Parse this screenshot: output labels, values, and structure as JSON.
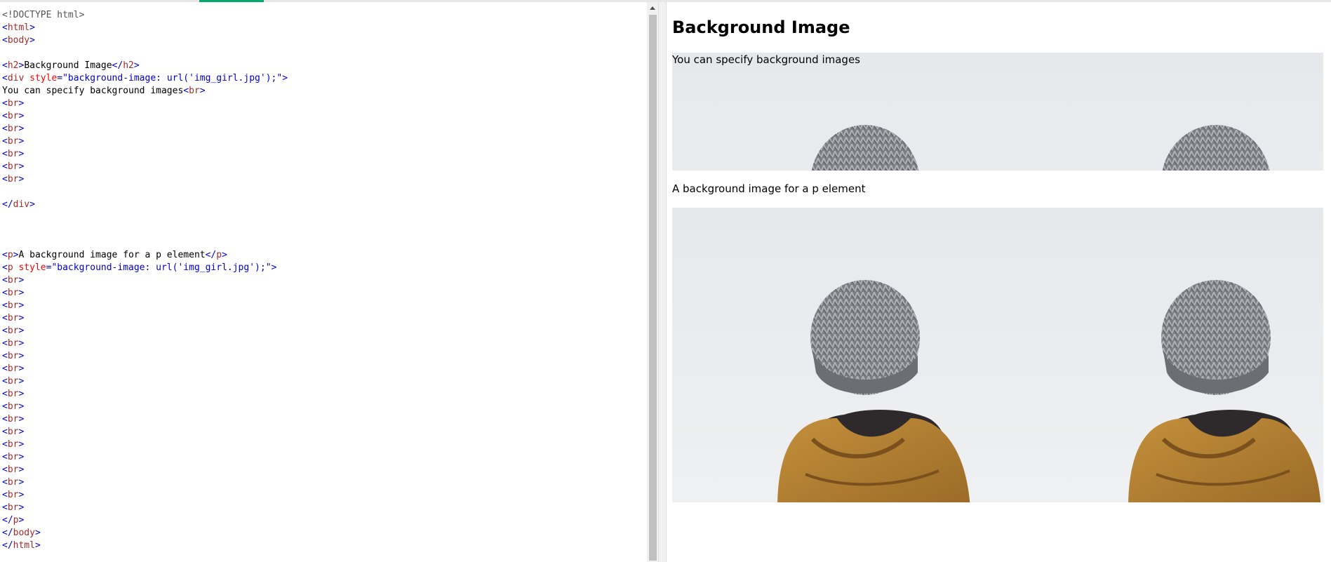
{
  "editor": {
    "lines": [
      {
        "tokens": [
          {
            "t": "doctype",
            "v": "<!DOCTYPE html>"
          }
        ]
      },
      {
        "tokens": [
          {
            "t": "angle",
            "v": "<"
          },
          {
            "t": "tag",
            "v": "html"
          },
          {
            "t": "angle",
            "v": ">"
          }
        ]
      },
      {
        "tokens": [
          {
            "t": "angle",
            "v": "<"
          },
          {
            "t": "tag",
            "v": "body"
          },
          {
            "t": "angle",
            "v": ">"
          }
        ]
      },
      {
        "tokens": []
      },
      {
        "tokens": [
          {
            "t": "angle",
            "v": "<"
          },
          {
            "t": "tag",
            "v": "h2"
          },
          {
            "t": "angle",
            "v": ">"
          },
          {
            "t": "text",
            "v": "Background Image"
          },
          {
            "t": "angle",
            "v": "</"
          },
          {
            "t": "tag",
            "v": "h2"
          },
          {
            "t": "angle",
            "v": ">"
          }
        ]
      },
      {
        "tokens": [
          {
            "t": "angle",
            "v": "<"
          },
          {
            "t": "tag",
            "v": "div"
          },
          {
            "t": "text",
            "v": " "
          },
          {
            "t": "attr",
            "v": "style"
          },
          {
            "t": "val",
            "v": "=\"background-image: url('img_girl.jpg');\""
          },
          {
            "t": "angle",
            "v": ">"
          }
        ]
      },
      {
        "tokens": [
          {
            "t": "text",
            "v": "You can specify background images"
          },
          {
            "t": "angle",
            "v": "<"
          },
          {
            "t": "tag",
            "v": "br"
          },
          {
            "t": "angle",
            "v": ">"
          }
        ]
      },
      {
        "tokens": [
          {
            "t": "angle",
            "v": "<"
          },
          {
            "t": "tag",
            "v": "br"
          },
          {
            "t": "angle",
            "v": ">"
          }
        ]
      },
      {
        "tokens": [
          {
            "t": "angle",
            "v": "<"
          },
          {
            "t": "tag",
            "v": "br"
          },
          {
            "t": "angle",
            "v": ">"
          }
        ]
      },
      {
        "tokens": [
          {
            "t": "angle",
            "v": "<"
          },
          {
            "t": "tag",
            "v": "br"
          },
          {
            "t": "angle",
            "v": ">"
          }
        ]
      },
      {
        "tokens": [
          {
            "t": "angle",
            "v": "<"
          },
          {
            "t": "tag",
            "v": "br"
          },
          {
            "t": "angle",
            "v": ">"
          }
        ]
      },
      {
        "tokens": [
          {
            "t": "angle",
            "v": "<"
          },
          {
            "t": "tag",
            "v": "br"
          },
          {
            "t": "angle",
            "v": ">"
          }
        ]
      },
      {
        "tokens": [
          {
            "t": "angle",
            "v": "<"
          },
          {
            "t": "tag",
            "v": "br"
          },
          {
            "t": "angle",
            "v": ">"
          }
        ]
      },
      {
        "tokens": [
          {
            "t": "angle",
            "v": "<"
          },
          {
            "t": "tag",
            "v": "br"
          },
          {
            "t": "angle",
            "v": ">"
          }
        ]
      },
      {
        "tokens": []
      },
      {
        "tokens": [
          {
            "t": "angle",
            "v": "</"
          },
          {
            "t": "tag",
            "v": "div"
          },
          {
            "t": "angle",
            "v": ">"
          }
        ]
      },
      {
        "tokens": []
      },
      {
        "tokens": []
      },
      {
        "tokens": []
      },
      {
        "tokens": [
          {
            "t": "angle",
            "v": "<"
          },
          {
            "t": "tag",
            "v": "p"
          },
          {
            "t": "angle",
            "v": ">"
          },
          {
            "t": "text",
            "v": "A background image for a p element"
          },
          {
            "t": "angle",
            "v": "</"
          },
          {
            "t": "tag",
            "v": "p"
          },
          {
            "t": "angle",
            "v": ">"
          }
        ]
      },
      {
        "tokens": [
          {
            "t": "angle",
            "v": "<"
          },
          {
            "t": "tag",
            "v": "p"
          },
          {
            "t": "text",
            "v": " "
          },
          {
            "t": "attr",
            "v": "style"
          },
          {
            "t": "val",
            "v": "=\"background-image: url('img_girl.jpg');\""
          },
          {
            "t": "angle",
            "v": ">"
          }
        ]
      },
      {
        "tokens": [
          {
            "t": "angle",
            "v": "<"
          },
          {
            "t": "tag",
            "v": "br"
          },
          {
            "t": "angle",
            "v": ">"
          }
        ]
      },
      {
        "tokens": [
          {
            "t": "angle",
            "v": "<"
          },
          {
            "t": "tag",
            "v": "br"
          },
          {
            "t": "angle",
            "v": ">"
          }
        ]
      },
      {
        "tokens": [
          {
            "t": "angle",
            "v": "<"
          },
          {
            "t": "tag",
            "v": "br"
          },
          {
            "t": "angle",
            "v": ">"
          }
        ]
      },
      {
        "tokens": [
          {
            "t": "angle",
            "v": "<"
          },
          {
            "t": "tag",
            "v": "br"
          },
          {
            "t": "angle",
            "v": ">"
          }
        ]
      },
      {
        "tokens": [
          {
            "t": "angle",
            "v": "<"
          },
          {
            "t": "tag",
            "v": "br"
          },
          {
            "t": "angle",
            "v": ">"
          }
        ]
      },
      {
        "tokens": [
          {
            "t": "angle",
            "v": "<"
          },
          {
            "t": "tag",
            "v": "br"
          },
          {
            "t": "angle",
            "v": ">"
          }
        ]
      },
      {
        "tokens": [
          {
            "t": "angle",
            "v": "<"
          },
          {
            "t": "tag",
            "v": "br"
          },
          {
            "t": "angle",
            "v": ">"
          }
        ]
      },
      {
        "tokens": [
          {
            "t": "angle",
            "v": "<"
          },
          {
            "t": "tag",
            "v": "br"
          },
          {
            "t": "angle",
            "v": ">"
          }
        ]
      },
      {
        "tokens": [
          {
            "t": "angle",
            "v": "<"
          },
          {
            "t": "tag",
            "v": "br"
          },
          {
            "t": "angle",
            "v": ">"
          }
        ]
      },
      {
        "tokens": [
          {
            "t": "angle",
            "v": "<"
          },
          {
            "t": "tag",
            "v": "br"
          },
          {
            "t": "angle",
            "v": ">"
          }
        ]
      },
      {
        "tokens": [
          {
            "t": "angle",
            "v": "<"
          },
          {
            "t": "tag",
            "v": "br"
          },
          {
            "t": "angle",
            "v": ">"
          }
        ]
      },
      {
        "tokens": [
          {
            "t": "angle",
            "v": "<"
          },
          {
            "t": "tag",
            "v": "br"
          },
          {
            "t": "angle",
            "v": ">"
          }
        ]
      },
      {
        "tokens": [
          {
            "t": "angle",
            "v": "<"
          },
          {
            "t": "tag",
            "v": "br"
          },
          {
            "t": "angle",
            "v": ">"
          }
        ]
      },
      {
        "tokens": [
          {
            "t": "angle",
            "v": "<"
          },
          {
            "t": "tag",
            "v": "br"
          },
          {
            "t": "angle",
            "v": ">"
          }
        ]
      },
      {
        "tokens": [
          {
            "t": "angle",
            "v": "<"
          },
          {
            "t": "tag",
            "v": "br"
          },
          {
            "t": "angle",
            "v": ">"
          }
        ]
      },
      {
        "tokens": [
          {
            "t": "angle",
            "v": "<"
          },
          {
            "t": "tag",
            "v": "br"
          },
          {
            "t": "angle",
            "v": ">"
          }
        ]
      },
      {
        "tokens": [
          {
            "t": "angle",
            "v": "<"
          },
          {
            "t": "tag",
            "v": "br"
          },
          {
            "t": "angle",
            "v": ">"
          }
        ]
      },
      {
        "tokens": [
          {
            "t": "angle",
            "v": "<"
          },
          {
            "t": "tag",
            "v": "br"
          },
          {
            "t": "angle",
            "v": ">"
          }
        ]
      },
      {
        "tokens": [
          {
            "t": "angle",
            "v": "<"
          },
          {
            "t": "tag",
            "v": "br"
          },
          {
            "t": "angle",
            "v": ">"
          }
        ]
      },
      {
        "tokens": [
          {
            "t": "angle",
            "v": "</"
          },
          {
            "t": "tag",
            "v": "p"
          },
          {
            "t": "angle",
            "v": ">"
          }
        ]
      },
      {
        "tokens": [
          {
            "t": "angle",
            "v": "</"
          },
          {
            "t": "tag",
            "v": "body"
          },
          {
            "t": "angle",
            "v": ">"
          }
        ]
      },
      {
        "tokens": [
          {
            "t": "angle",
            "v": "</"
          },
          {
            "t": "tag",
            "v": "html"
          },
          {
            "t": "angle",
            "v": ">"
          }
        ]
      }
    ],
    "colors": {
      "tag": "#a52a2a",
      "angle": "#0000cd",
      "attr": "#ff0000",
      "value": "#0000cd",
      "text": "#000000"
    }
  },
  "preview": {
    "heading": "Background Image",
    "div_text": "You can specify background images",
    "paragraph_text": "A background image for a p element",
    "background_image": "photo-person-knit-beanie-mustard-jacket-back-view"
  },
  "theme": {
    "accent": "#04aa6d"
  }
}
